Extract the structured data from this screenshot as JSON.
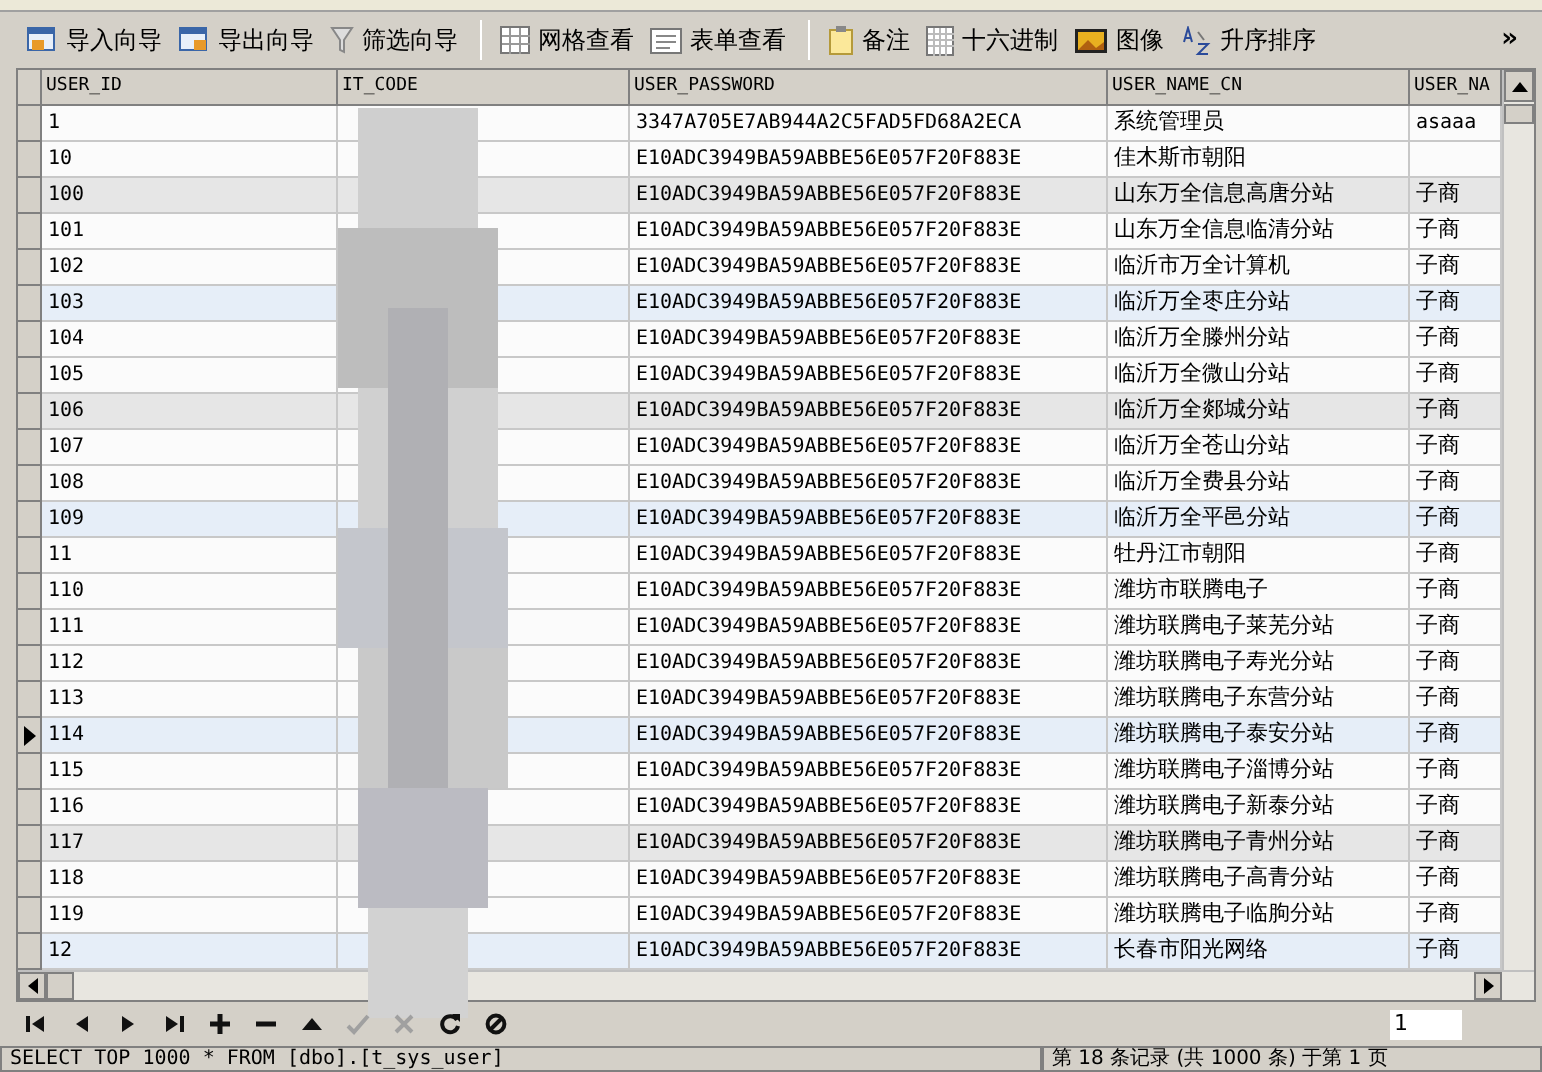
{
  "toolbar": [
    {
      "kind": "import",
      "label": "导入向导"
    },
    {
      "kind": "export",
      "label": "导出向导"
    },
    {
      "kind": "filter",
      "label": "筛选向导"
    },
    {
      "kind": "grid",
      "label": "网格查看"
    },
    {
      "kind": "form",
      "label": "表单查看"
    },
    {
      "kind": "note",
      "label": "备注"
    },
    {
      "kind": "hex",
      "label": "十六进制"
    },
    {
      "label": "图像"
    },
    {
      "kind": "sort",
      "label": "升序排序"
    }
  ],
  "toolbar_more": "»",
  "table": {
    "columns": [
      "USER_ID",
      "IT_CODE",
      "USER_PASSWORD",
      "USER_NAME_CN",
      "USER_NA"
    ],
    "rows": [
      {
        "cells": [
          "1",
          "",
          "3347A705E7AB944A2C5FAD5FD68A2ECA",
          "系统管理员",
          "asaaa"
        ],
        "kind": "plain",
        "selected": false
      },
      {
        "cells": [
          "10",
          "",
          "E10ADC3949BA59ABBE56E057F20F883E",
          "佳木斯市朝阳",
          ""
        ],
        "kind": "plain",
        "selected": false
      },
      {
        "cells": [
          "100",
          "",
          "E10ADC3949BA59ABBE56E057F20F883E",
          "山东万全信息高唐分站",
          "子商"
        ],
        "kind": "gray",
        "selected": false
      },
      {
        "cells": [
          "101",
          "",
          "E10ADC3949BA59ABBE56E057F20F883E",
          "山东万全信息临清分站",
          "子商"
        ],
        "kind": "plain",
        "selected": false
      },
      {
        "cells": [
          "102",
          "",
          "E10ADC3949BA59ABBE56E057F20F883E",
          "临沂市万全计算机",
          "子商"
        ],
        "kind": "plain",
        "selected": false
      },
      {
        "cells": [
          "103",
          "",
          "E10ADC3949BA59ABBE56E057F20F883E",
          "临沂万全枣庄分站",
          "子商"
        ],
        "kind": "blue",
        "selected": false
      },
      {
        "cells": [
          "104",
          "",
          "E10ADC3949BA59ABBE56E057F20F883E",
          "临沂万全滕州分站",
          "子商"
        ],
        "kind": "plain",
        "selected": false
      },
      {
        "cells": [
          "105",
          "",
          "E10ADC3949BA59ABBE56E057F20F883E",
          "临沂万全微山分站",
          "子商"
        ],
        "kind": "plain",
        "selected": false
      },
      {
        "cells": [
          "106",
          "",
          "E10ADC3949BA59ABBE56E057F20F883E",
          "临沂万全郯城分站",
          "子商"
        ],
        "kind": "gray",
        "selected": false
      },
      {
        "cells": [
          "107",
          "",
          "E10ADC3949BA59ABBE56E057F20F883E",
          "临沂万全苍山分站",
          "子商"
        ],
        "kind": "plain",
        "selected": false
      },
      {
        "cells": [
          "108",
          "",
          "E10ADC3949BA59ABBE56E057F20F883E",
          "临沂万全费县分站",
          "子商"
        ],
        "kind": "plain",
        "selected": false
      },
      {
        "cells": [
          "109",
          "",
          "E10ADC3949BA59ABBE56E057F20F883E",
          "临沂万全平邑分站",
          "子商"
        ],
        "kind": "blue",
        "selected": false
      },
      {
        "cells": [
          "11",
          "",
          "E10ADC3949BA59ABBE56E057F20F883E",
          "牡丹江市朝阳",
          "子商"
        ],
        "kind": "plain",
        "selected": false
      },
      {
        "cells": [
          "110",
          "",
          "E10ADC3949BA59ABBE56E057F20F883E",
          "潍坊市联腾电子",
          "子商"
        ],
        "kind": "plain",
        "selected": false
      },
      {
        "cells": [
          "111",
          "",
          "E10ADC3949BA59ABBE56E057F20F883E",
          "潍坊联腾电子莱芜分站",
          "子商"
        ],
        "kind": "plain",
        "selected": false
      },
      {
        "cells": [
          "112",
          "",
          "E10ADC3949BA59ABBE56E057F20F883E",
          "潍坊联腾电子寿光分站",
          "子商"
        ],
        "kind": "plain",
        "selected": false
      },
      {
        "cells": [
          "113",
          "",
          "E10ADC3949BA59ABBE56E057F20F883E",
          "潍坊联腾电子东营分站",
          "子商"
        ],
        "kind": "plain",
        "selected": false
      },
      {
        "cells": [
          "114",
          "",
          "E10ADC3949BA59ABBE56E057F20F883E",
          "潍坊联腾电子泰安分站",
          "子商"
        ],
        "kind": "blue",
        "selected": true
      },
      {
        "cells": [
          "115",
          "",
          "E10ADC3949BA59ABBE56E057F20F883E",
          "潍坊联腾电子淄博分站",
          "子商"
        ],
        "kind": "plain",
        "selected": false
      },
      {
        "cells": [
          "116",
          "",
          "E10ADC3949BA59ABBE56E057F20F883E",
          "潍坊联腾电子新泰分站",
          "子商"
        ],
        "kind": "plain",
        "selected": false
      },
      {
        "cells": [
          "117",
          "",
          "E10ADC3949BA59ABBE56E057F20F883E",
          "潍坊联腾电子青州分站",
          "子商"
        ],
        "kind": "gray",
        "selected": false
      },
      {
        "cells": [
          "118",
          "",
          "E10ADC3949BA59ABBE56E057F20F883E",
          "潍坊联腾电子高青分站",
          "子商"
        ],
        "kind": "plain",
        "selected": false
      },
      {
        "cells": [
          "119",
          "",
          "E10ADC3949BA59ABBE56E057F20F883E",
          "潍坊联腾电子临朐分站",
          "子商"
        ],
        "kind": "plain",
        "selected": false
      },
      {
        "cells": [
          "12",
          "",
          "E10ADC3949BA59ABBE56E057F20F883E",
          "长春市阳光网络",
          "子商"
        ],
        "kind": "blue",
        "selected": false
      }
    ]
  },
  "navigator": [
    {
      "kind": "first",
      "disabled": false
    },
    {
      "kind": "prev",
      "disabled": false
    },
    {
      "kind": "next",
      "disabled": false
    },
    {
      "kind": "last",
      "disabled": false
    },
    {
      "kind": "add",
      "disabled": false
    },
    {
      "kind": "delete",
      "disabled": false
    },
    {
      "kind": "up",
      "disabled": false
    },
    {
      "kind": "check",
      "disabled": true
    },
    {
      "kind": "cancel",
      "disabled": true
    },
    {
      "kind": "refresh",
      "disabled": false
    },
    {
      "kind": "stop",
      "disabled": false
    }
  ],
  "page_field": {
    "value": "1"
  },
  "status_bar": {
    "query": "SELECT TOP 1000 * FROM [dbo].[t_sys_user]",
    "record": "第 18 条记录 (共 1000 条) 于第 1 页"
  }
}
